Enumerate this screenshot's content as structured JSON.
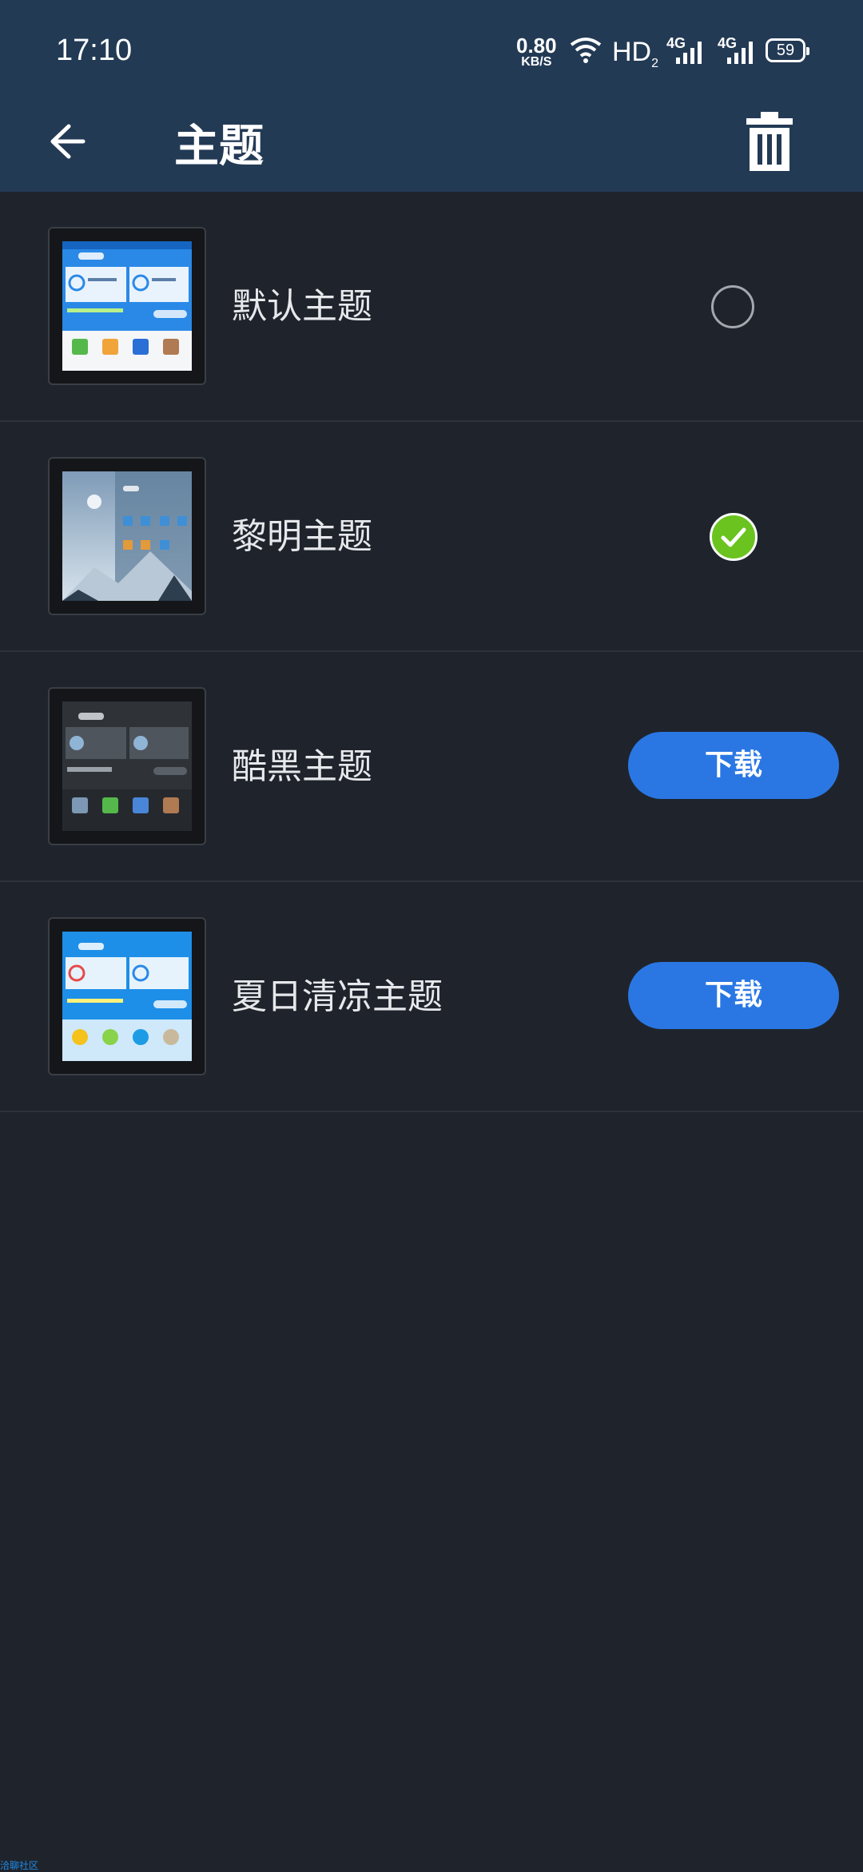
{
  "status_bar": {
    "time": "17:10",
    "net_speed_value": "0.80",
    "net_speed_unit": "KB/S",
    "hd_label": "HD",
    "hd_sub": "2",
    "sim1_label": "4G",
    "sim2_label": "4G",
    "battery": "59"
  },
  "app_bar": {
    "title": "主题",
    "back_icon": "arrow-left-icon",
    "trash_icon": "trash-icon"
  },
  "themes": [
    {
      "name": "默认主题",
      "state": "unselected"
    },
    {
      "name": "黎明主题",
      "state": "selected"
    },
    {
      "name": "酷黑主题",
      "state": "download",
      "button_label": "下载"
    },
    {
      "name": "夏日清凉主题",
      "state": "download",
      "button_label": "下载"
    }
  ],
  "colors": {
    "header": "#233a55",
    "background": "#1f242c",
    "accent": "#2a77e4",
    "check": "#6ac31e"
  },
  "watermark": "洽聊社区"
}
